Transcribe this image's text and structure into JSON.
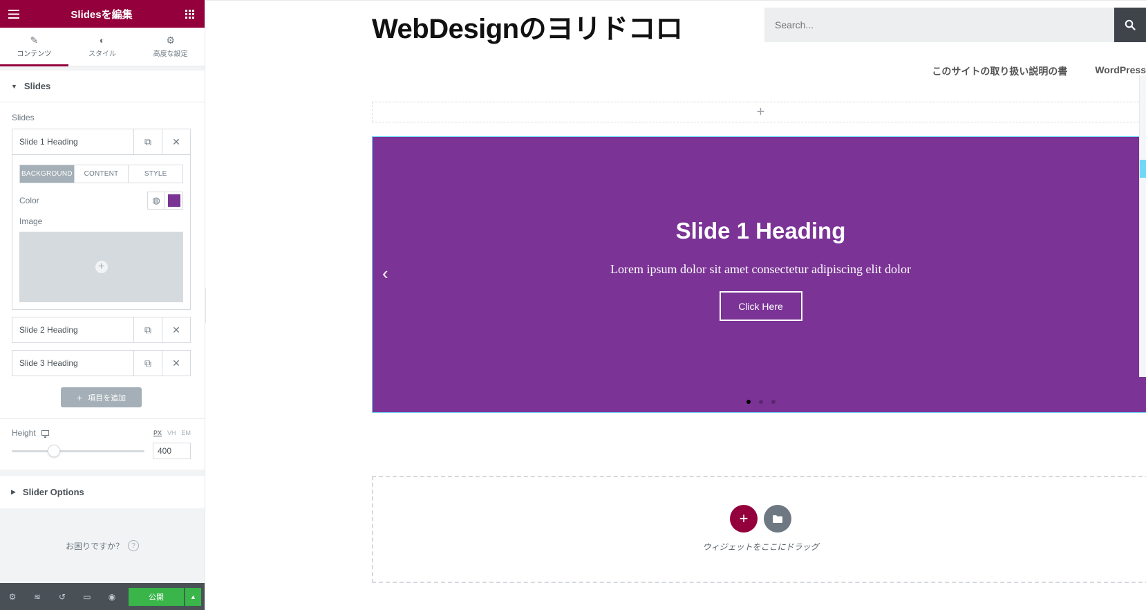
{
  "panel": {
    "title": "Slidesを編集",
    "tabs": [
      {
        "label": "コンテンツ",
        "icon": "pencil-icon"
      },
      {
        "label": "スタイル",
        "icon": "half-circle-icon"
      },
      {
        "label": "高度な設定",
        "icon": "gear-icon"
      }
    ],
    "section_slides": "Slides",
    "slides_label": "Slides",
    "items": [
      {
        "title": "Slide 1 Heading"
      },
      {
        "title": "Slide 2 Heading"
      },
      {
        "title": "Slide 3 Heading"
      }
    ],
    "inner_tabs": [
      "BACKGROUND",
      "CONTENT",
      "STYLE"
    ],
    "color_label": "Color",
    "color_value": "#7a3493",
    "image_label": "Image",
    "add_item_label": "項目を追加",
    "height_label": "Height",
    "height_units": [
      "PX",
      "VH",
      "EM"
    ],
    "height_value": "400",
    "height_slider_fraction": 0.32,
    "section_slider_options": "Slider Options",
    "help_text": "お困りですか？",
    "help_icon": "?",
    "publish_label": "公開"
  },
  "site": {
    "title": "WebDesignのヨリドコロ",
    "search_placeholder": "Search...",
    "nav": [
      "このサイトの取り扱い説明の書",
      "WordPress"
    ]
  },
  "slide": {
    "heading": "Slide 1 Heading",
    "description": "Lorem ipsum dolor sit amet consectetur adipiscing elit dolor",
    "button": "Click Here",
    "background": "#7b3396",
    "prev_arrow": "‹",
    "next_arrow": "›"
  },
  "drop_zone": {
    "text": "ウィジェットをここにドラッグ"
  },
  "colors": {
    "accent": "#93003c",
    "publish": "#39b54a",
    "selection": "#71d7f7"
  }
}
